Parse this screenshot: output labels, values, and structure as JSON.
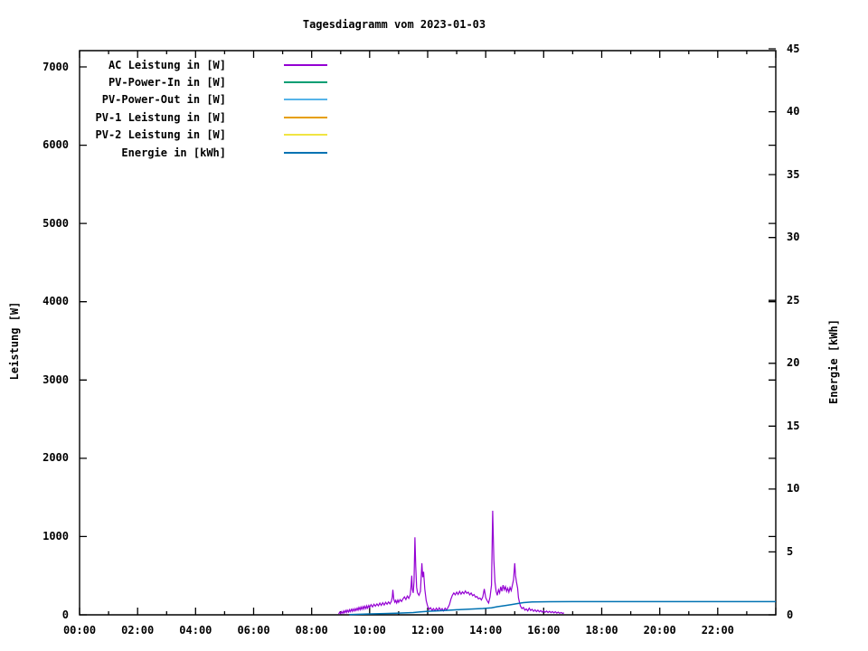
{
  "page": {
    "background_color": "#ffffff"
  },
  "chart_data": {
    "type": "line",
    "title": "Tagesdiagramm vom 2023-01-03",
    "ylabel": "Leistung [W]",
    "y2label": "Energie [kWh]",
    "grid": false,
    "legend_position": "top-left-inside",
    "x_axis": {
      "range_hours": [
        0,
        24
      ],
      "major_tick_step_hours": 2,
      "minor_tick_step_hours": 1,
      "tick_labels": [
        "00:00",
        "02:00",
        "04:00",
        "06:00",
        "08:00",
        "10:00",
        "12:00",
        "14:00",
        "16:00",
        "18:00",
        "20:00",
        "22:00"
      ],
      "tick_hours": [
        0,
        2,
        4,
        6,
        8,
        10,
        12,
        14,
        16,
        18,
        20,
        22
      ]
    },
    "y_axis_left": {
      "label": "Leistung [W]",
      "units": "W",
      "tick_step": 1000,
      "tick_values": [
        0,
        1000,
        2000,
        3000,
        4000,
        5000,
        6000,
        7000
      ],
      "tick_labels": [
        "0",
        "1000",
        "2000",
        "3000",
        "4000",
        "5000",
        "6000",
        "7000"
      ]
    },
    "y_axis_right": {
      "label": "Energie [kWh]",
      "units": "kWh",
      "tick_step": 5,
      "range": [
        0,
        45
      ],
      "tick_values": [
        0,
        5,
        10,
        15,
        20,
        25,
        30,
        35,
        40,
        45
      ],
      "tick_labels": [
        "0",
        "5",
        "10",
        "15",
        "20",
        "25",
        "30",
        "35",
        "40",
        "45"
      ]
    },
    "legend": [
      {
        "label": "AC Leistung in [W]",
        "color": "#9400D3"
      },
      {
        "label": "PV-Power-In in [W]",
        "color": "#009E73"
      },
      {
        "label": "PV-Power-Out in [W]",
        "color": "#56B4E9"
      },
      {
        "label": "PV-1 Leistung in [W]",
        "color": "#E69F00"
      },
      {
        "label": "PV-2 Leistung in [W]",
        "color": "#F0E442"
      },
      {
        "label": "Energie in [kWh]",
        "color": "#0072B2"
      }
    ],
    "series": [
      {
        "name": "AC Leistung in [W]",
        "color": "#9400D3",
        "axis": "left",
        "units": "W",
        "points": [
          [
            8.93,
            10
          ],
          [
            8.97,
            35
          ],
          [
            9.0,
            15
          ],
          [
            9.03,
            40
          ],
          [
            9.07,
            20
          ],
          [
            9.1,
            50
          ],
          [
            9.13,
            25
          ],
          [
            9.17,
            55
          ],
          [
            9.2,
            30
          ],
          [
            9.23,
            60
          ],
          [
            9.27,
            35
          ],
          [
            9.3,
            65
          ],
          [
            9.33,
            40
          ],
          [
            9.37,
            70
          ],
          [
            9.4,
            45
          ],
          [
            9.43,
            75
          ],
          [
            9.47,
            50
          ],
          [
            9.5,
            80
          ],
          [
            9.53,
            55
          ],
          [
            9.57,
            85
          ],
          [
            9.6,
            60
          ],
          [
            9.63,
            95
          ],
          [
            9.67,
            65
          ],
          [
            9.7,
            100
          ],
          [
            9.73,
            70
          ],
          [
            9.77,
            105
          ],
          [
            9.8,
            75
          ],
          [
            9.83,
            110
          ],
          [
            9.87,
            80
          ],
          [
            9.9,
            115
          ],
          [
            9.93,
            85
          ],
          [
            9.97,
            120
          ],
          [
            10.0,
            95
          ],
          [
            10.05,
            130
          ],
          [
            10.1,
            100
          ],
          [
            10.15,
            135
          ],
          [
            10.2,
            110
          ],
          [
            10.25,
            140
          ],
          [
            10.3,
            115
          ],
          [
            10.35,
            150
          ],
          [
            10.4,
            120
          ],
          [
            10.45,
            155
          ],
          [
            10.5,
            125
          ],
          [
            10.55,
            160
          ],
          [
            10.6,
            135
          ],
          [
            10.65,
            165
          ],
          [
            10.7,
            140
          ],
          [
            10.75,
            175
          ],
          [
            10.78,
            230
          ],
          [
            10.8,
            320
          ],
          [
            10.83,
            200
          ],
          [
            10.87,
            160
          ],
          [
            10.9,
            185
          ],
          [
            10.93,
            150
          ],
          [
            10.97,
            190
          ],
          [
            11.0,
            160
          ],
          [
            11.05,
            195
          ],
          [
            11.1,
            170
          ],
          [
            11.15,
            205
          ],
          [
            11.2,
            230
          ],
          [
            11.25,
            195
          ],
          [
            11.3,
            240
          ],
          [
            11.35,
            210
          ],
          [
            11.4,
            260
          ],
          [
            11.43,
            380
          ],
          [
            11.45,
            500
          ],
          [
            11.47,
            330
          ],
          [
            11.5,
            280
          ],
          [
            11.53,
            420
          ],
          [
            11.56,
            990
          ],
          [
            11.59,
            620
          ],
          [
            11.62,
            350
          ],
          [
            11.65,
            280
          ],
          [
            11.7,
            250
          ],
          [
            11.75,
            300
          ],
          [
            11.8,
            660
          ],
          [
            11.83,
            480
          ],
          [
            11.86,
            550
          ],
          [
            11.9,
            330
          ],
          [
            11.95,
            180
          ],
          [
            12.0,
            110
          ],
          [
            12.05,
            70
          ],
          [
            12.1,
            90
          ],
          [
            12.15,
            55
          ],
          [
            12.2,
            80
          ],
          [
            12.25,
            50
          ],
          [
            12.3,
            85
          ],
          [
            12.35,
            55
          ],
          [
            12.4,
            90
          ],
          [
            12.45,
            60
          ],
          [
            12.5,
            80
          ],
          [
            12.55,
            50
          ],
          [
            12.6,
            85
          ],
          [
            12.65,
            60
          ],
          [
            12.7,
            95
          ],
          [
            12.75,
            130
          ],
          [
            12.8,
            200
          ],
          [
            12.85,
            250
          ],
          [
            12.9,
            280
          ],
          [
            12.95,
            255
          ],
          [
            13.0,
            290
          ],
          [
            13.05,
            260
          ],
          [
            13.1,
            300
          ],
          [
            13.15,
            265
          ],
          [
            13.2,
            295
          ],
          [
            13.25,
            270
          ],
          [
            13.3,
            305
          ],
          [
            13.35,
            275
          ],
          [
            13.4,
            290
          ],
          [
            13.45,
            255
          ],
          [
            13.5,
            280
          ],
          [
            13.55,
            245
          ],
          [
            13.6,
            260
          ],
          [
            13.65,
            225
          ],
          [
            13.7,
            235
          ],
          [
            13.75,
            205
          ],
          [
            13.8,
            215
          ],
          [
            13.85,
            190
          ],
          [
            13.9,
            230
          ],
          [
            13.95,
            330
          ],
          [
            13.98,
            270
          ],
          [
            14.0,
            220
          ],
          [
            14.05,
            180
          ],
          [
            14.1,
            150
          ],
          [
            14.15,
            230
          ],
          [
            14.2,
            380
          ],
          [
            14.24,
            1330
          ],
          [
            14.28,
            700
          ],
          [
            14.32,
            420
          ],
          [
            14.36,
            300
          ],
          [
            14.4,
            250
          ],
          [
            14.44,
            320
          ],
          [
            14.48,
            280
          ],
          [
            14.52,
            360
          ],
          [
            14.56,
            300
          ],
          [
            14.6,
            380
          ],
          [
            14.64,
            320
          ],
          [
            14.68,
            360
          ],
          [
            14.72,
            300
          ],
          [
            14.76,
            340
          ],
          [
            14.8,
            290
          ],
          [
            14.84,
            350
          ],
          [
            14.88,
            310
          ],
          [
            14.92,
            380
          ],
          [
            14.96,
            450
          ],
          [
            15.0,
            660
          ],
          [
            15.03,
            500
          ],
          [
            15.06,
            420
          ],
          [
            15.1,
            340
          ],
          [
            15.13,
            220
          ],
          [
            15.17,
            150
          ],
          [
            15.2,
            110
          ],
          [
            15.25,
            80
          ],
          [
            15.3,
            95
          ],
          [
            15.35,
            60
          ],
          [
            15.4,
            75
          ],
          [
            15.45,
            50
          ],
          [
            15.5,
            85
          ],
          [
            15.55,
            55
          ],
          [
            15.6,
            70
          ],
          [
            15.65,
            45
          ],
          [
            15.7,
            65
          ],
          [
            15.75,
            40
          ],
          [
            15.8,
            60
          ],
          [
            15.85,
            38
          ],
          [
            15.9,
            55
          ],
          [
            15.95,
            35
          ],
          [
            16.0,
            50
          ],
          [
            16.05,
            32
          ],
          [
            16.1,
            48
          ],
          [
            16.15,
            30
          ],
          [
            16.2,
            45
          ],
          [
            16.25,
            28
          ],
          [
            16.3,
            42
          ],
          [
            16.35,
            25
          ],
          [
            16.4,
            40
          ],
          [
            16.45,
            22
          ],
          [
            16.5,
            35
          ],
          [
            16.55,
            20
          ],
          [
            16.6,
            30
          ],
          [
            16.65,
            18
          ],
          [
            16.7,
            25
          ]
        ]
      },
      {
        "name": "PV-Power-In in [W]",
        "color": "#009E73",
        "axis": "left",
        "units": "W",
        "points": []
      },
      {
        "name": "PV-Power-Out in [W]",
        "color": "#56B4E9",
        "axis": "left",
        "units": "W",
        "points": []
      },
      {
        "name": "PV-1 Leistung in [W]",
        "color": "#E69F00",
        "axis": "left",
        "units": "W",
        "points": []
      },
      {
        "name": "PV-2 Leistung in [W]",
        "color": "#F0E442",
        "axis": "left",
        "units": "W",
        "points": []
      },
      {
        "name": "Energie in [kWh]",
        "color": "#0072B2",
        "axis": "right",
        "units": "kWh",
        "points": [
          [
            9.3,
            0.02
          ],
          [
            10.0,
            0.07
          ],
          [
            10.5,
            0.1
          ],
          [
            11.0,
            0.14
          ],
          [
            11.5,
            0.18
          ],
          [
            11.7,
            0.22
          ],
          [
            12.0,
            0.28
          ],
          [
            12.5,
            0.33
          ],
          [
            13.0,
            0.4
          ],
          [
            13.5,
            0.46
          ],
          [
            13.9,
            0.5
          ],
          [
            14.2,
            0.56
          ],
          [
            14.4,
            0.65
          ],
          [
            14.7,
            0.75
          ],
          [
            14.9,
            0.82
          ],
          [
            15.1,
            0.9
          ],
          [
            15.3,
            0.97
          ],
          [
            15.6,
            1.02
          ],
          [
            16.2,
            1.04
          ],
          [
            17.0,
            1.05
          ],
          [
            24.0,
            1.05
          ]
        ]
      }
    ]
  }
}
